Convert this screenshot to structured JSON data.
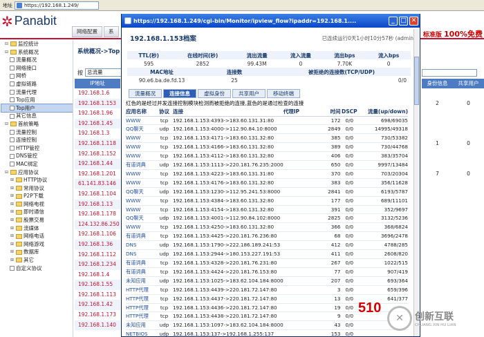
{
  "browser": {
    "url": "https://192.168.1.249/"
  },
  "app": {
    "brand": "Panabit",
    "ad_prefix": "标准版",
    "ad_main": "100%免费"
  },
  "topnav": [
    "网络配置",
    "系"
  ],
  "tree": [
    {
      "label": "监控统计",
      "level": 0,
      "folder": true
    },
    {
      "label": "系统概况",
      "level": 0,
      "folder": true
    },
    {
      "label": "流量概况",
      "level": 1
    },
    {
      "label": "网络接口",
      "level": 1
    },
    {
      "label": "网桥",
      "level": 1
    },
    {
      "label": "虚拟链路",
      "level": 1
    },
    {
      "label": "流量代理",
      "level": 1
    },
    {
      "label": "Top应用",
      "level": 1
    },
    {
      "label": "Top用户",
      "level": 1,
      "selected": true
    },
    {
      "label": "其它信息",
      "level": 1
    },
    {
      "label": "首前策略",
      "level": 0,
      "folder": true
    },
    {
      "label": "流量控制",
      "level": 1
    },
    {
      "label": "连接控制",
      "level": 1
    },
    {
      "label": "HTTP管控",
      "level": 1
    },
    {
      "label": "DNS管控",
      "level": 1
    },
    {
      "label": "MAC绑定",
      "level": 1
    },
    {
      "label": "应用协议",
      "level": 0,
      "folder": true
    },
    {
      "label": "HTTP协议",
      "level": 1,
      "folder": true
    },
    {
      "label": "常用协议",
      "level": 1,
      "folder": true
    },
    {
      "label": "P2P下载",
      "level": 1,
      "folder": true
    },
    {
      "label": "网络电视",
      "level": 1,
      "folder": true
    },
    {
      "label": "即时通信",
      "level": 1,
      "folder": true
    },
    {
      "label": "股票交易",
      "level": 1,
      "folder": true
    },
    {
      "label": "流媒体",
      "level": 1,
      "folder": true
    },
    {
      "label": "网络电话",
      "level": 1,
      "folder": true
    },
    {
      "label": "网络游戏",
      "level": 1,
      "folder": true
    },
    {
      "label": "数据库",
      "level": 1,
      "folder": true
    },
    {
      "label": "其它",
      "level": 1,
      "folder": true
    },
    {
      "label": "自定义协议",
      "level": 1
    }
  ],
  "main": {
    "breadcrumb": "系统概况->Top",
    "filter_label": "按",
    "filter_value": "总流量",
    "ip_header": "IP地址",
    "ips": [
      "192.168.1.6",
      "192.168.1.153",
      "192.168.1.96",
      "192.168.1.45",
      "192.168.1.3",
      "192.168.1.118",
      "192.168.1.152",
      "192.168.1.44",
      "192.168.1.201",
      "61.141.83.146",
      "192.168.1.104",
      "192.168.1.13",
      "192.168.1.178",
      "124.132.86.250",
      "192.168.1.106",
      "192.168.1.36",
      "192.168.1.112",
      "192.168.1.234",
      "192.168.1.4",
      "192.168.1.55",
      "192.168.1.113",
      "192.168.1.42",
      "192.168.1.173",
      "192.168.1.140"
    ],
    "right_headers": [
      "身份信息",
      "共享用户"
    ],
    "right_values": [
      [
        "",
        ""
      ],
      [
        "2",
        "0"
      ],
      [
        "",
        ""
      ],
      [
        "",
        ""
      ],
      [
        "",
        ""
      ],
      [
        "1",
        "0"
      ],
      [
        "",
        ""
      ],
      [
        "",
        ""
      ],
      [
        "7",
        "0"
      ],
      [
        "",
        ""
      ],
      [
        "",
        ""
      ],
      [
        "",
        ""
      ],
      [
        "",
        ""
      ],
      [
        "",
        ""
      ],
      [
        "",
        ""
      ],
      [
        "",
        ""
      ],
      [
        "",
        ""
      ],
      [
        "",
        ""
      ],
      [
        "",
        ""
      ],
      [
        "",
        ""
      ],
      [
        "",
        ""
      ],
      [
        "",
        ""
      ],
      [
        "",
        ""
      ],
      [
        "",
        ""
      ]
    ]
  },
  "popup": {
    "title": "https://192.168.1.249/cgi-bin/Monitor/ipview_flow?ipaddr=192.168.1....",
    "heading": "192.168.1.153档案",
    "runtime": "已连续运行0天1小时10分57秒 (admin)",
    "summary_headers1": [
      "TTL(秒)",
      "在线时间(秒)",
      "流出流量",
      "流入流量",
      "流出bps",
      "流入bps"
    ],
    "summary_values1": [
      "595",
      "2852",
      "99.43M",
      "0",
      "7.70K",
      "0"
    ],
    "summary_headers2": [
      "MAC地址",
      "连接数",
      "被拒绝的连接数(TCP/UDP)"
    ],
    "summary_values2": [
      "90.e6.ba.de.fd.13",
      "25",
      "0/0"
    ],
    "tabs": [
      "流量概况",
      "连接信息",
      "虚拟身份",
      "共享用户",
      "移动终端"
    ],
    "active_tab": 1,
    "legend": "红色的是经过并发连接控制模块检测而被拒绝的连接,蓝色的是通过检查的连接",
    "conn_headers": [
      "应用名称",
      "协议",
      "连接",
      "代理IP",
      "时间",
      "DSCP",
      "流量(up/down)"
    ],
    "connections": [
      [
        "WWW",
        "tcp",
        "192.168.1.153:4393->183.60.131.31:80",
        "",
        "172",
        "0/0",
        "698/69035"
      ],
      [
        "QQ聊天",
        "udp",
        "192.168.1.153:4000->112.90.84.10:8000",
        "",
        "2849",
        "0/0",
        "14995/49318"
      ],
      [
        "WWW",
        "tcp",
        "192.168.1.153:4171->183.60.131.32:80",
        "",
        "385",
        "0/0",
        "730/53382"
      ],
      [
        "WWW",
        "tcp",
        "192.168.1.153:4166->183.60.131.32:80",
        "",
        "389",
        "0/0",
        "730/44768"
      ],
      [
        "WWW",
        "tcp",
        "192.168.1.153:4112->183.60.131.32:80",
        "",
        "406",
        "0/0",
        "383/35704"
      ],
      [
        "有道词典",
        "udp",
        "192.168.1.153:1113->220.181.76.235:2000",
        "",
        "650",
        "0/0",
        "9997/13484"
      ],
      [
        "WWW",
        "tcp",
        "192.168.1.153:4223->183.60.131.31:80",
        "",
        "370",
        "0/0",
        "703/20304"
      ],
      [
        "WWW",
        "tcp",
        "192.168.1.153:4176->183.60.131.32:80",
        "",
        "383",
        "0/0",
        "356/11628"
      ],
      [
        "QQ聊天",
        "udp",
        "192.168.1.153:1230->112.95.241.53:8000",
        "",
        "2841",
        "0/0",
        "6193/5787"
      ],
      [
        "WWW",
        "tcp",
        "192.168.1.153:4384->183.60.131.32:80",
        "",
        "177",
        "0/0",
        "689/11101"
      ],
      [
        "WWW",
        "tcp",
        "192.168.1.153:4154->183.60.131.32:80",
        "",
        "391",
        "0/0",
        "352/9697"
      ],
      [
        "QQ聊天",
        "udp",
        "192.168.1.153:4001->112.90.84.102:8000",
        "",
        "2825",
        "0/0",
        "3132/5236"
      ],
      [
        "WWW",
        "tcp",
        "192.168.1.153:4250->183.60.131.32:80",
        "",
        "366",
        "0/0",
        "368/6824"
      ],
      [
        "有道词典",
        "tcp",
        "192.168.1.153:4425->220.181.76.236:80",
        "",
        "68",
        "0/0",
        "3696/2478"
      ],
      [
        "DNS",
        "udp",
        "192.168.1.153:1790->222.186.189.241:53",
        "",
        "412",
        "0/0",
        "4788/285"
      ],
      [
        "DNS",
        "udp",
        "192.168.1.153:2944->180.153.227.191:53",
        "",
        "411",
        "0/0",
        "2608/820"
      ],
      [
        "有道词典",
        "tcp",
        "192.168.1.153:4328->220.181.76.231:80",
        "",
        "267",
        "0/0",
        "1022/515"
      ],
      [
        "有道词典",
        "tcp",
        "192.168.1.153:4424->220.181.76.153:80",
        "",
        "77",
        "0/0",
        "907/419"
      ],
      [
        "未知应用",
        "udp",
        "192.168.1.153:1025->183.62.104.184:8000",
        "",
        "207",
        "0/0",
        "693/364"
      ],
      [
        "HTTP代理",
        "tcp",
        "192.168.1.153:4439->220.181.72.147:80",
        "",
        "3",
        "0/0",
        "659/396"
      ],
      [
        "HTTP代理",
        "tcp",
        "192.168.1.153:4437->220.181.72.147:80",
        "",
        "13",
        "0/0",
        "641/377"
      ],
      [
        "HTTP代理",
        "tcp",
        "192.168.1.153:4436->220.181.72.147:80",
        "",
        "19",
        "0/0",
        ""
      ],
      [
        "HTTP代理",
        "tcp",
        "192.168.1.153:4438->220.181.72.147:80",
        "",
        "9",
        "0/0",
        ""
      ],
      [
        "未知应用",
        "udp",
        "192.168.1.153:1097->183.62.104.184:8000",
        "",
        "43",
        "0/0",
        ""
      ],
      [
        "NETBIOS",
        "udp",
        "192.168.1.153:137->192.168.1.255:137",
        "",
        "153",
        "0/0",
        ""
      ]
    ]
  },
  "watermark": {
    "number": "510",
    "brand": "创新互联",
    "sub": "CHUANG XIN HU LIAN"
  },
  "icons": {
    "brand": "panabit-logo-icon",
    "page": "page-icon",
    "folder": "folder-icon"
  },
  "colors": {
    "brand_red": "#c8102e",
    "header_blue": "#4d7cc2",
    "titlebar": "#0a46c8"
  }
}
